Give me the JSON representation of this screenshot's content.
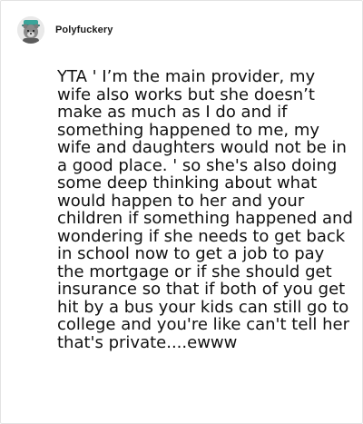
{
  "post": {
    "author": {
      "username": "Polyfuckery",
      "avatar_icon": "bear-avatar-icon"
    },
    "text": "YTA ' I’m the main provider, my wife also works but she doesn’t make as much as I do and if something happened to me, my wife and daughters would not be in a good place. ' so she's also doing some deep thinking about what would happen to her and your children if something happened and wondering if she needs to get back in school now to get a job to pay the mortgage or if she should get insurance so that if both of you get hit by a bus your kids can still go to college and you're like can't tell her that's private....ewww"
  },
  "colors": {
    "background": "#ffffff",
    "border": "#e3e3e3",
    "text": "#111111",
    "avatar_accent": "#3aa59a"
  }
}
